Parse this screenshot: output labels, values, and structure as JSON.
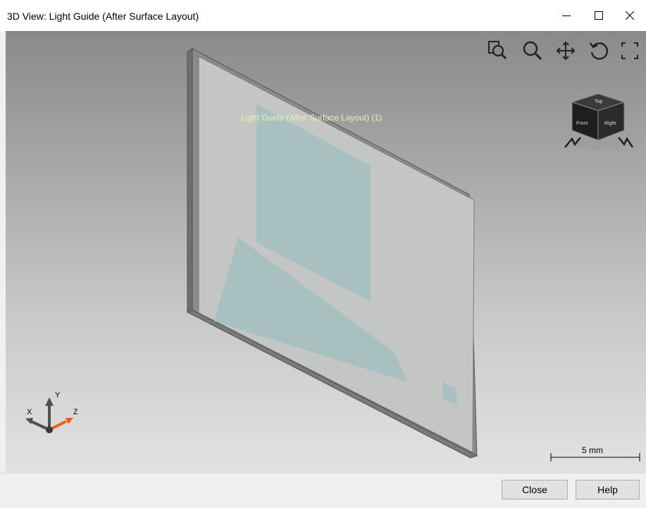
{
  "window": {
    "title": "3D View: Light Guide (After Surface Layout)"
  },
  "titlebar": {
    "minimize_icon": "minimize-icon",
    "maximize_icon": "maximize-icon",
    "close_icon": "close-icon"
  },
  "toolbar": {
    "icons": [
      "zoom-extents-icon",
      "zoom-icon",
      "pan-icon",
      "rotate-icon",
      "fit-to-view-icon"
    ]
  },
  "view_cube": {
    "faces": [
      "Top",
      "Front",
      "Right"
    ]
  },
  "scene": {
    "surface_label": "Light Guide (After Surface Layout) (1)",
    "colors": {
      "plate_face": "#c7c9c9",
      "plate_edge": "#6e6e6e",
      "layout_region": "#a9c2c1",
      "background_top": "#8a8a8a",
      "background_bottom": "#e2e2e2"
    }
  },
  "axes": {
    "x_label": "X",
    "y_label": "Y",
    "z_label": "Z"
  },
  "scale_bar": {
    "label": "5 mm"
  },
  "footer": {
    "close_label": "Close",
    "help_label": "Help"
  }
}
